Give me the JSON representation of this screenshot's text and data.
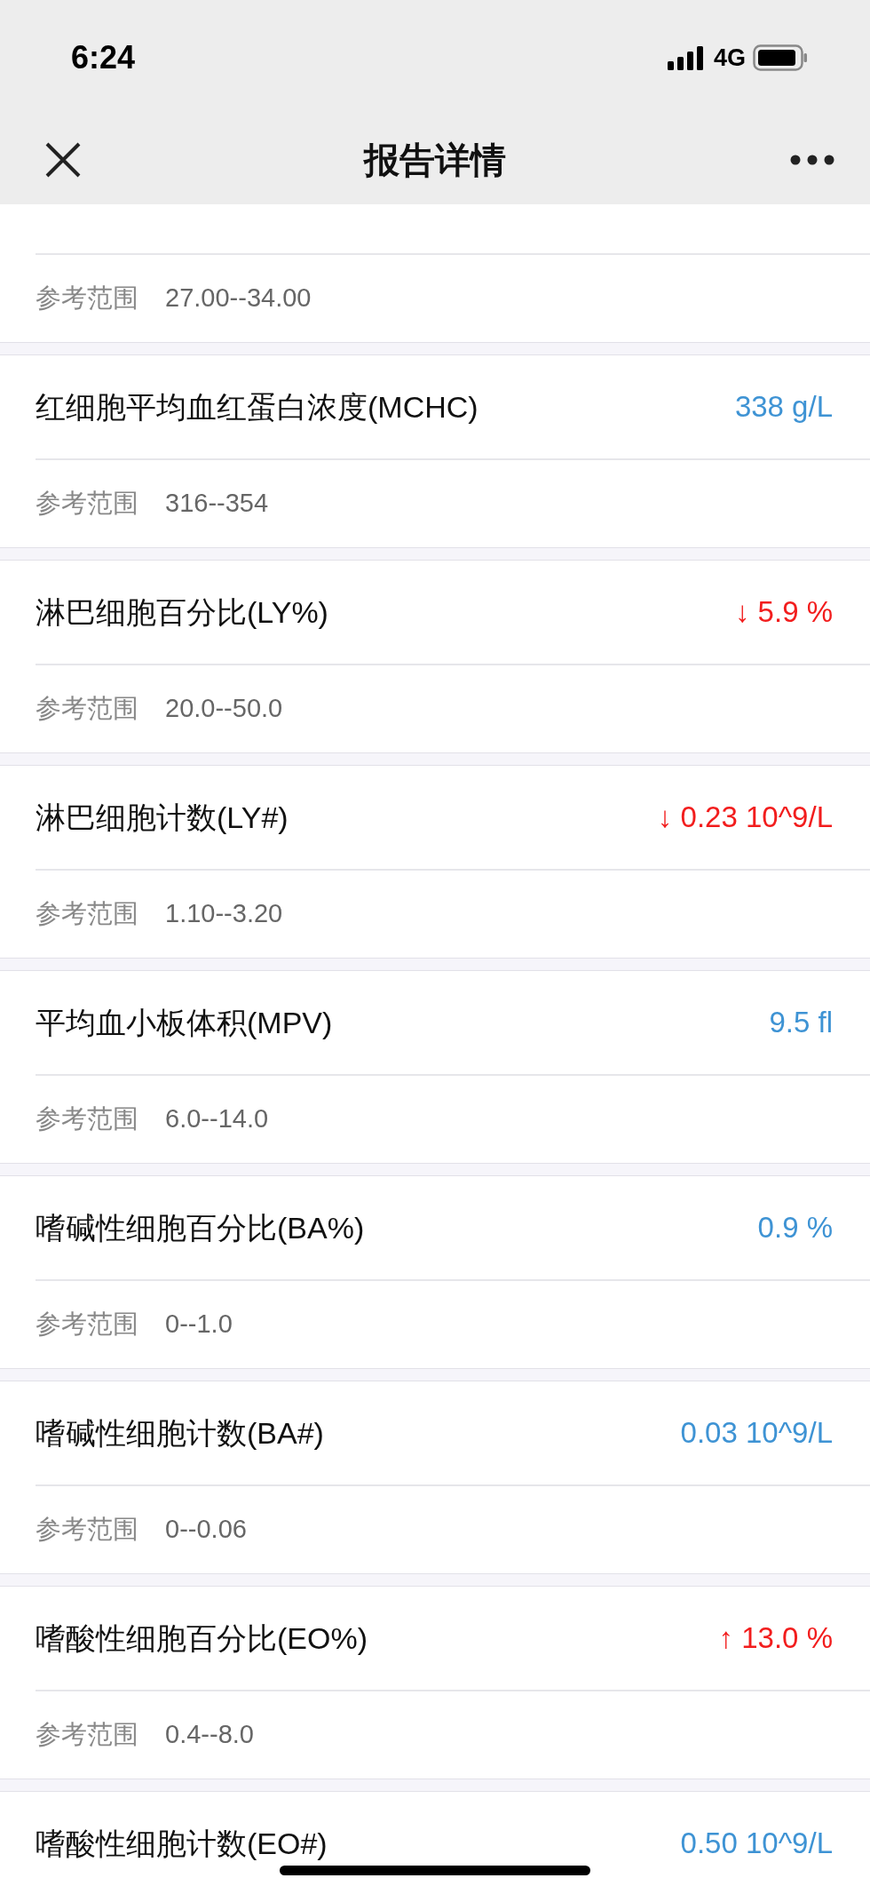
{
  "status_bar": {
    "time": "6:24",
    "network": "4G"
  },
  "nav": {
    "title": "报告详情"
  },
  "items": [
    {
      "range_label": "参考范围",
      "range": "27.00--34.00"
    },
    {
      "name": "红细胞平均血红蛋白浓度(MCHC)",
      "value": "338 g/L",
      "color": "#3e93d4",
      "range_label": "参考范围",
      "range": "316--354"
    },
    {
      "name": "淋巴细胞百分比(LY%)",
      "arrow": "↓",
      "value": "5.9 %",
      "color": "#f21d1d",
      "range_label": "参考范围",
      "range": "20.0--50.0"
    },
    {
      "name": "淋巴细胞计数(LY#)",
      "arrow": "↓",
      "value": "0.23 10^9/L",
      "color": "#f21d1d",
      "range_label": "参考范围",
      "range": "1.10--3.20"
    },
    {
      "name": "平均血小板体积(MPV)",
      "value": "9.5 fl",
      "color": "#3e93d4",
      "range_label": "参考范围",
      "range": "6.0--14.0"
    },
    {
      "name": "嗜碱性细胞百分比(BA%)",
      "value": "0.9 %",
      "color": "#3e93d4",
      "range_label": "参考范围",
      "range": "0--1.0"
    },
    {
      "name": "嗜碱性细胞计数(BA#)",
      "value": "0.03 10^9/L",
      "color": "#3e93d4",
      "range_label": "参考范围",
      "range": "0--0.06"
    },
    {
      "name": "嗜酸性细胞百分比(EO%)",
      "arrow": "↑",
      "value": "13.0 %",
      "color": "#f21d1d",
      "range_label": "参考范围",
      "range": "0.4--8.0"
    },
    {
      "name": "嗜酸性细胞计数(EO#)",
      "value": "0.50 10^9/L",
      "color": "#3e93d4"
    }
  ]
}
